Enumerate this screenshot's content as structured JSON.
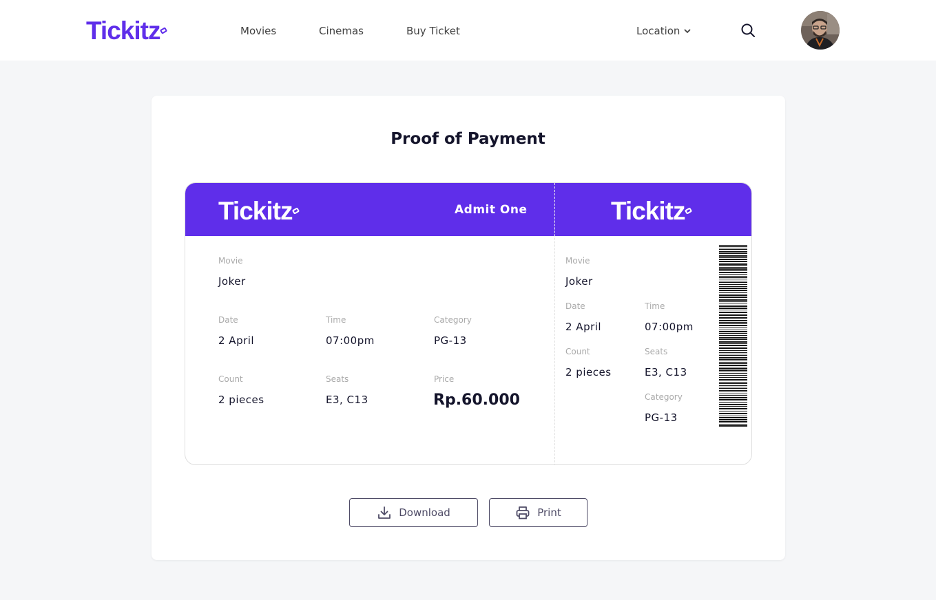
{
  "header": {
    "brand": "Tickitz",
    "nav": [
      "Movies",
      "Cinemas",
      "Buy Ticket"
    ],
    "location_label": "Location"
  },
  "page": {
    "title": "Proof of Payment"
  },
  "ticket": {
    "brand": "Tickitz",
    "admit": "Admit One",
    "main": {
      "movie_label": "Movie",
      "movie": "Joker",
      "date_label": "Date",
      "date": "2 April",
      "time_label": "Time",
      "time": "07:00pm",
      "category_label": "Category",
      "category": "PG-13",
      "count_label": "Count",
      "count": "2 pieces",
      "seats_label": "Seats",
      "seats": "E3, C13",
      "price_label": "Price",
      "price": "Rp.60.000"
    },
    "stub": {
      "movie_label": "Movie",
      "movie": "Joker",
      "date_label": "Date",
      "date": "2 April",
      "time_label": "Time",
      "time": "07:00pm",
      "count_label": "Count",
      "count": "2 pieces",
      "seats_label": "Seats",
      "seats": "E3, C13",
      "category_label": "Category",
      "category": "PG-13"
    }
  },
  "actions": {
    "download": "Download",
    "print": "Print"
  },
  "colors": {
    "brand": "#5F2EEA",
    "background": "#F5F6F8",
    "text": "#14142B"
  },
  "icons": [
    "search-icon",
    "chevron-down-icon",
    "download-icon",
    "printer-icon"
  ]
}
